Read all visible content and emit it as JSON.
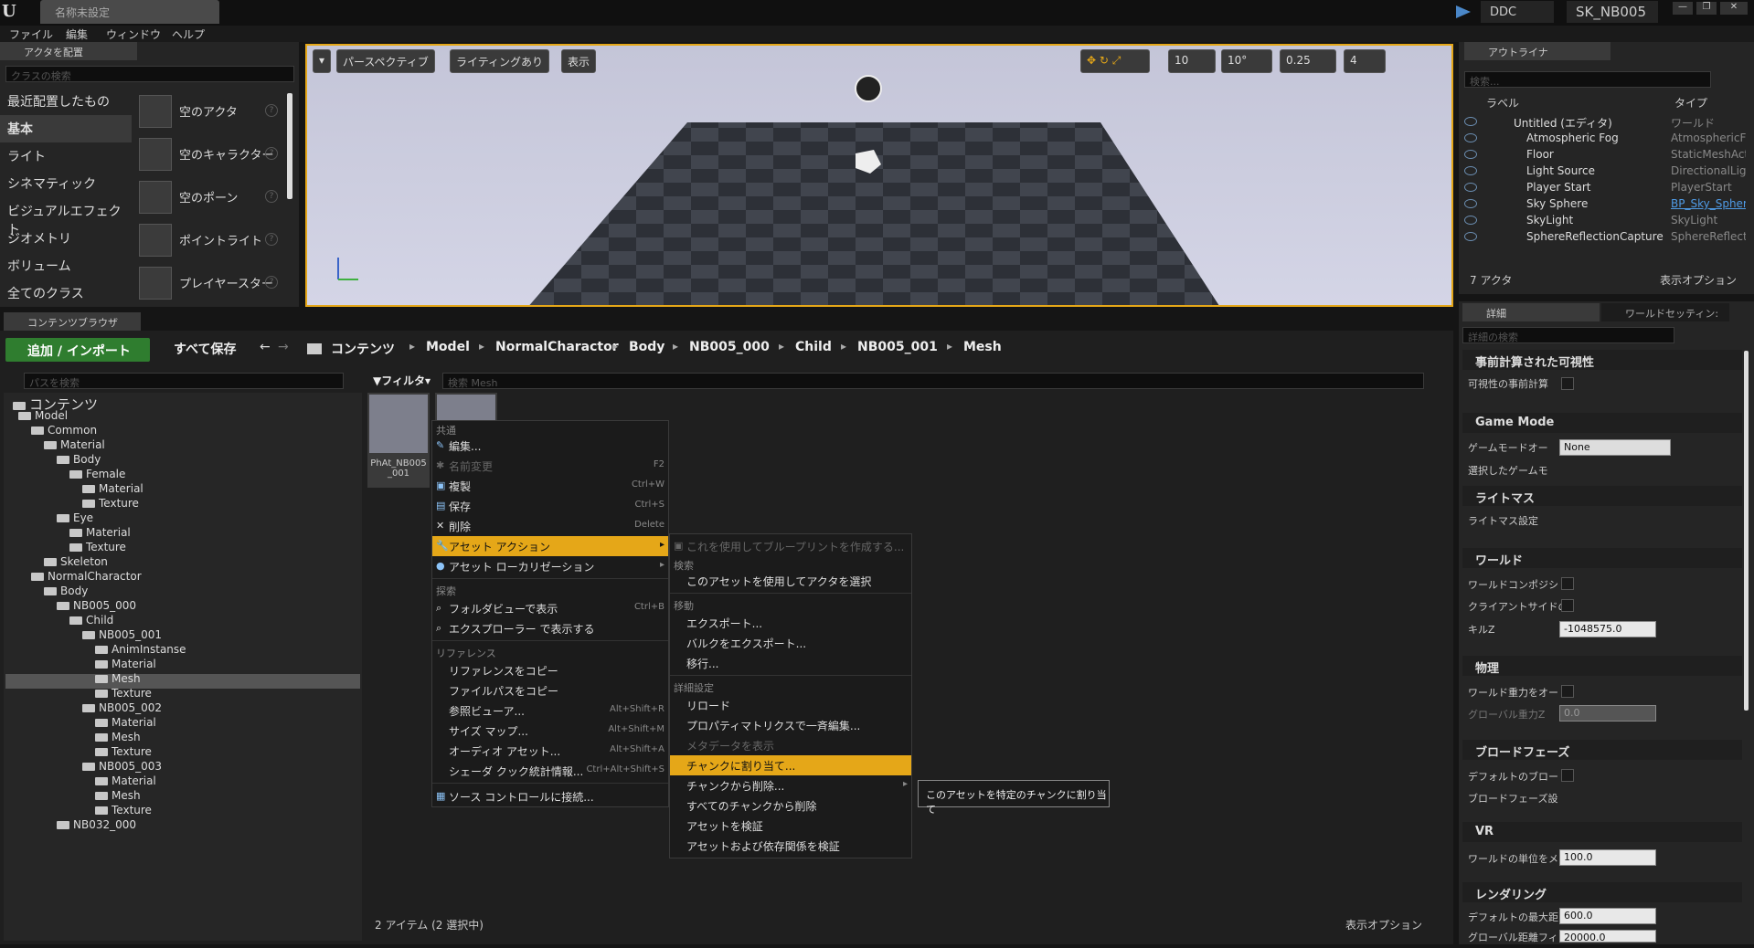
{
  "titlebar": {
    "tab": "名称未設定",
    "ddc": "DDC",
    "project": "SK_NB005"
  },
  "menubar": [
    "ファイル",
    "編集",
    "ウィンドウ",
    "ヘルプ"
  ],
  "place": {
    "title": "アクタを配置",
    "search": "クラスの検索",
    "categories": [
      "最近配置したもの",
      "基本",
      "ライト",
      "シネマティック",
      "ビジュアルエフェクト",
      "ジオメトリ",
      "ボリューム",
      "全てのクラス"
    ],
    "items": [
      "空のアクタ",
      "空のキャラクター",
      "空のポーン",
      "ポイントライト",
      "プレイヤースター"
    ]
  },
  "viewport": {
    "perspective": "パースペクティブ",
    "lighting": "ライティングあり",
    "show": "表示",
    "grid": "10",
    "angle": "10°",
    "scale": "0.25",
    "speed": "4"
  },
  "outliner": {
    "title": "アウトライナ",
    "search": "検索...",
    "col_label": "ラベル",
    "col_type": "タイプ",
    "root": "Untitled (エディタ)",
    "root_type": "ワールド",
    "rows": [
      {
        "n": "Atmospheric Fog",
        "t": "AtmosphericFo"
      },
      {
        "n": "Floor",
        "t": "StaticMeshActo"
      },
      {
        "n": "Light Source",
        "t": "DirectionalLight"
      },
      {
        "n": "Player Start",
        "t": "PlayerStart"
      },
      {
        "n": "Sky Sphere",
        "t": "BP_Sky_Spher"
      },
      {
        "n": "SkyLight",
        "t": "SkyLight"
      },
      {
        "n": "SphereReflectionCapture",
        "t": "SphereReflectio"
      }
    ],
    "count": "7 アクタ",
    "view": "表示オプション"
  },
  "details": {
    "tab1": "詳細",
    "tab2": "ワールドセッティン:",
    "search": "詳細の検索",
    "sections": {
      "s1": "事前計算された可視性",
      "s2": "Game Mode",
      "s3": "ライトマス",
      "s4": "ワールド",
      "s5": "物理",
      "s6": "ブロードフェーズ",
      "s7": "VR",
      "s8": "レンダリング"
    },
    "rows": {
      "r1": "可視性の事前計算",
      "r2": "ゲームモードオー",
      "r2v": "None",
      "r3": "選択したゲームモ",
      "r4": "ライトマス設定",
      "r5": "ワールドコンポジシ",
      "r6": "クライアントサイドの",
      "r7": "キルZ",
      "r7v": "-1048575.0",
      "r8": "ワールド重力をオー",
      "r9": "グローバル重力Z",
      "r9v": "0.0",
      "r10": "デフォルトのブロー",
      "r11": "ブロードフェーズ設",
      "r12": "ワールドの単位をメ",
      "r12v": "100.0",
      "r13": "デフォルトの最大距",
      "r13v": "600.0",
      "r14": "グローバル距離フィ",
      "r14v": "20000.0"
    }
  },
  "cb": {
    "title": "コンテンツブラウザ",
    "add": "追加 / インポート",
    "save": "すべて保存",
    "crumbs": [
      "コンテンツ",
      "Model",
      "NormalCharactor",
      "Body",
      "NB005_000",
      "Child",
      "NB005_001",
      "Mesh"
    ],
    "path_search": "パスを検索",
    "filter": "フィルタ",
    "search": "検索 Mesh",
    "asset1": "PhAt_NB005_001",
    "status": "2 アイテム (2 選択中)",
    "view": "表示オプション"
  },
  "tree": [
    {
      "t": "コンテンツ",
      "d": 0
    },
    {
      "t": "Model",
      "d": 1
    },
    {
      "t": "Common",
      "d": 2
    },
    {
      "t": "Material",
      "d": 3
    },
    {
      "t": "Body",
      "d": 4
    },
    {
      "t": "Female",
      "d": 5
    },
    {
      "t": "Material",
      "d": 6
    },
    {
      "t": "Texture",
      "d": 6
    },
    {
      "t": "Eye",
      "d": 4
    },
    {
      "t": "Material",
      "d": 5
    },
    {
      "t": "Texture",
      "d": 5
    },
    {
      "t": "Skeleton",
      "d": 3
    },
    {
      "t": "NormalCharactor",
      "d": 2
    },
    {
      "t": "Body",
      "d": 3
    },
    {
      "t": "NB005_000",
      "d": 4
    },
    {
      "t": "Child",
      "d": 5
    },
    {
      "t": "NB005_001",
      "d": 6
    },
    {
      "t": "AnimInstanse",
      "d": 7
    },
    {
      "t": "Material",
      "d": 7
    },
    {
      "t": "Mesh",
      "d": 7
    },
    {
      "t": "Texture",
      "d": 7
    },
    {
      "t": "NB005_002",
      "d": 6
    },
    {
      "t": "Material",
      "d": 7
    },
    {
      "t": "Mesh",
      "d": 7
    },
    {
      "t": "Texture",
      "d": 7
    },
    {
      "t": "NB005_003",
      "d": 6
    },
    {
      "t": "Material",
      "d": 7
    },
    {
      "t": "Mesh",
      "d": 7
    },
    {
      "t": "Texture",
      "d": 7
    },
    {
      "t": "NB032_000",
      "d": 4
    }
  ],
  "menu1": {
    "h_common": "共通",
    "edit": "編集...",
    "rename": "名前変更",
    "rename_sc": "F2",
    "dup": "複製",
    "dup_sc": "Ctrl+W",
    "save": "保存",
    "save_sc": "Ctrl+S",
    "del": "削除",
    "del_sc": "Delete",
    "asset_action": "アセット アクション",
    "localize": "アセット ローカリゼーション",
    "h_search": "探索",
    "folder": "フォルダビューで表示",
    "folder_sc": "Ctrl+B",
    "explorer": "エクスプローラー で表示する",
    "h_ref": "リファレンス",
    "copyref": "リファレンスをコピー",
    "copypath": "ファイルパスをコピー",
    "refview": "参照ビューア...",
    "refview_sc": "Alt+Shift+R",
    "sizemap": "サイズ マップ...",
    "sizemap_sc": "Alt+Shift+M",
    "audio": "オーディオ アセット...",
    "audio_sc": "Alt+Shift+A",
    "shader": "シェーダ クック統計情報...",
    "shader_sc": "Ctrl+Alt+Shift+S",
    "source": "ソース コントロールに接続..."
  },
  "menu2": {
    "bp": "これを使用してブループリントを作成する...",
    "h_search": "検索",
    "select": "このアセットを使用してアクタを選択",
    "h_move": "移動",
    "export": "エクスポート...",
    "bulk": "バルクをエクスポート...",
    "migrate": "移行...",
    "h_adv": "詳細設定",
    "reload": "リロード",
    "matrix": "プロパティマトリクスで一斉編集...",
    "meta": "メタデータを表示",
    "chunk": "チャンクに割り当て...",
    "rmchunk": "チャンクから削除...",
    "rmall": "すべてのチャンクから削除",
    "validate": "アセットを検証",
    "validate_dep": "アセットおよび依存関係を検証"
  },
  "tooltip": "このアセットを特定のチャンクに割り当て"
}
